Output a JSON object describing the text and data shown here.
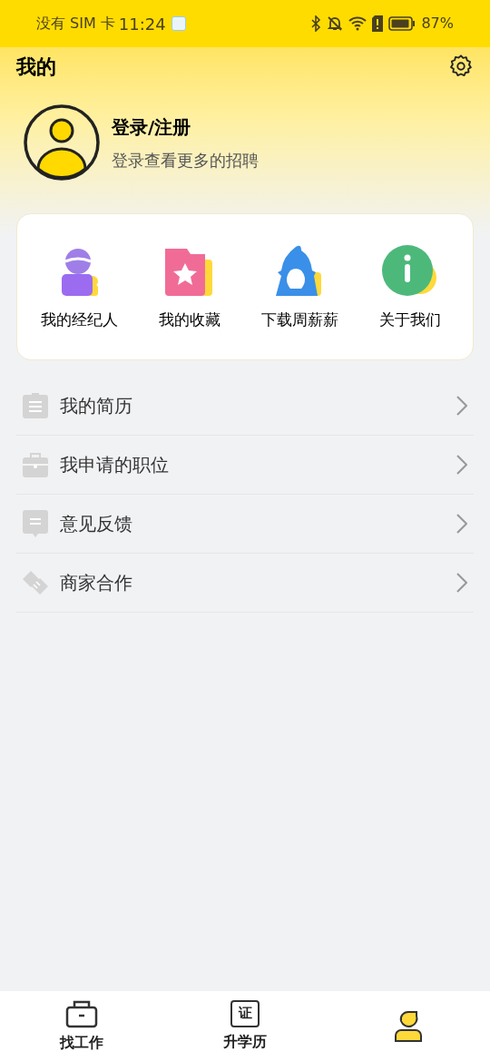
{
  "status_bar": {
    "carrier": "没有 SIM 卡",
    "time": "11:24",
    "battery": "87%"
  },
  "header": {
    "title": "我的"
  },
  "profile": {
    "title": "登录/注册",
    "subtitle": "登录查看更多的招聘"
  },
  "shortcuts": [
    {
      "kind": "agent",
      "label": "我的经纪人"
    },
    {
      "kind": "favorites",
      "label": "我的收藏"
    },
    {
      "kind": "download",
      "label": "下载周薪薪"
    },
    {
      "kind": "about",
      "label": "关于我们"
    }
  ],
  "menu": [
    {
      "kind": "resume",
      "label": "我的简历"
    },
    {
      "kind": "applied",
      "label": "我申请的职位"
    },
    {
      "kind": "feedback",
      "label": "意见反馈"
    },
    {
      "kind": "partner",
      "label": "商家合作"
    }
  ],
  "tabs": [
    {
      "kind": "jobs",
      "label": "找工作",
      "selected": false
    },
    {
      "kind": "education",
      "label": "升学历",
      "icon_text": "证",
      "selected": false
    },
    {
      "kind": "me",
      "selected": true
    }
  ]
}
